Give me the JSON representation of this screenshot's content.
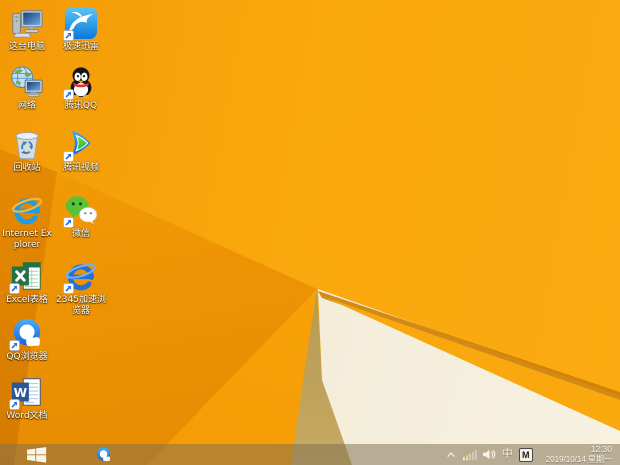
{
  "wallpaper": {
    "base_color": "#f8a50c",
    "left_dark_color": "#d47a00",
    "shadow_color": "#83682a",
    "cream_color": "#f3ecd9",
    "crease_edge_color": "#cd7e02"
  },
  "desktop": {
    "icons": [
      {
        "name": "this-pc",
        "label": "这台电脑"
      },
      {
        "name": "thunder-speed",
        "label": "极速迅雷"
      },
      {
        "name": "network",
        "label": "网络"
      },
      {
        "name": "tencent-qq",
        "label": "腾讯QQ"
      },
      {
        "name": "recycle-bin",
        "label": "回收站"
      },
      {
        "name": "tencent-video",
        "label": "腾讯视频"
      },
      {
        "name": "internet-explorer",
        "label": "Internet Explorer"
      },
      {
        "name": "wechat",
        "label": "微信"
      },
      {
        "name": "excel",
        "label": "Excel表格"
      },
      {
        "name": "browser-2345",
        "label": "2345加速浏览器"
      },
      {
        "name": "qq-browser",
        "label": "QQ浏览器"
      },
      {
        "name": "word",
        "label": "Word文档"
      }
    ]
  },
  "taskbar": {
    "tray": {
      "ime_mode": "中",
      "ime_badge": "M",
      "time": "12:30",
      "date": "2019/10/14 星期一"
    }
  }
}
